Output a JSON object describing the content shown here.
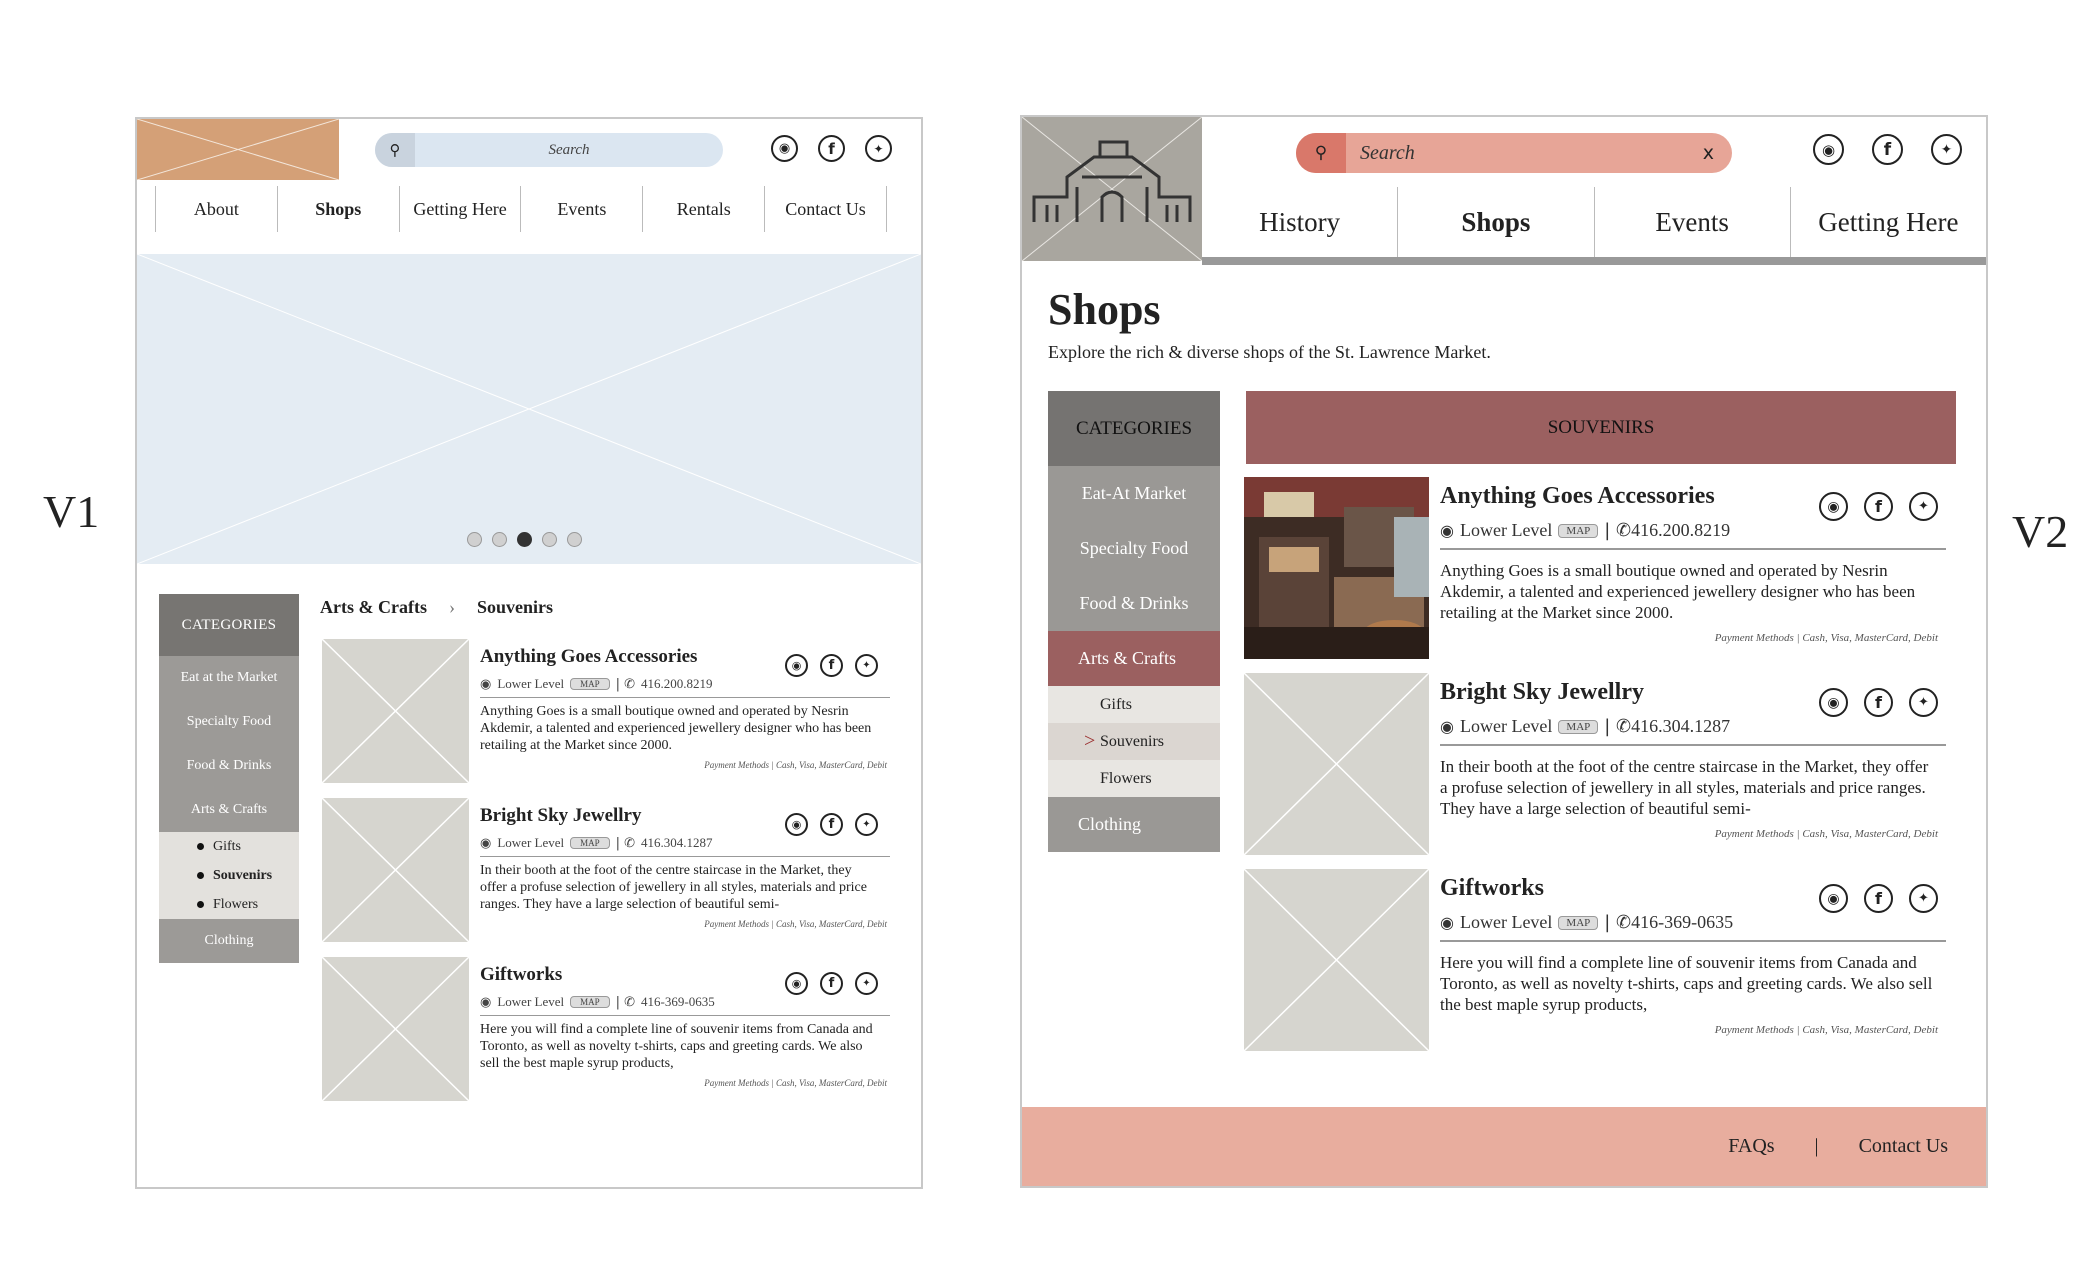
{
  "labels": {
    "v1": "V1",
    "v2": "V2"
  },
  "colors": {
    "v1_logo": "#d4a077",
    "v1_search_bg": "#dbe6f1",
    "v2_search_bg": "#e7a597",
    "v2_accent": "#9b6060",
    "v2_footer": "#e8ad9e",
    "placeholder": "#d6d5cf"
  },
  "v1": {
    "search_placeholder": "Search",
    "social_icons": [
      "instagram-icon",
      "facebook-icon",
      "twitter-icon"
    ],
    "nav": [
      "About",
      "Shops",
      "Getting Here",
      "Events",
      "Rentals",
      "Contact Us"
    ],
    "active_nav": "Shops",
    "carousel": {
      "count": 5,
      "active": 3
    },
    "categories": {
      "heading": "CATEGORIES",
      "items": [
        "Eat at the Market",
        "Specialty Food",
        "Food & Drinks",
        "Arts & Crafts"
      ],
      "sub_items": [
        "Gifts",
        "Souvenirs",
        "Flowers"
      ],
      "active_sub": "Souvenirs",
      "last_item": "Clothing"
    },
    "breadcrumb": {
      "parent": "Arts & Crafts",
      "separator": "›",
      "current": "Souvenirs"
    }
  },
  "v2": {
    "search_placeholder": "Search",
    "search_clear": "x",
    "nav": [
      "History",
      "Shops",
      "Events",
      "Getting Here"
    ],
    "active_nav": "Shops",
    "page_title": "Shops",
    "page_subtitle": "Explore the rich & diverse shops of the St. Lawrence Market.",
    "category_banner": "SOUVENIRS",
    "categories": {
      "heading": "CATEGORIES",
      "items": [
        "Eat-At Market",
        "Specialty Food",
        "Food & Drinks",
        "Arts & Crafts"
      ],
      "sub_items": [
        "Gifts",
        "Souvenirs",
        "Flowers"
      ],
      "active_sub": "Souvenirs",
      "active_marker": ">",
      "last_item": "Clothing"
    },
    "footer": {
      "faqs": "FAQs",
      "separator": "|",
      "contact": "Contact Us"
    }
  },
  "shops": [
    {
      "name": "Anything Goes Accessories",
      "location": "Lower Level",
      "map": "MAP",
      "phone": "416.200.8219",
      "desc": "Anything Goes is a small boutique owned and operated by Nesrin Akdemir, a talented and experienced jewellery designer who has been retailing at the Market since 2000.",
      "payment": "Payment Methods | Cash, Visa, MasterCard, Debit"
    },
    {
      "name": "Bright Sky Jewellry",
      "location": "Lower Level",
      "map": "MAP",
      "phone": "416.304.1287",
      "desc": "In their booth at the foot of the centre staircase in the Market, they offer a profuse selection of jewellery in all styles, materials and price ranges. They have a large selection of beautiful semi-",
      "payment": "Payment Methods | Cash, Visa, MasterCard, Debit"
    },
    {
      "name": "Giftworks",
      "location": "Lower Level",
      "map": "MAP",
      "phone": "416-369-0635",
      "desc": "Here you will find a complete line of souvenir items from Canada and Toronto, as well as novelty t-shirts, caps and greeting cards. We also sell the best maple syrup products,",
      "payment": "Payment Methods | Cash, Visa, MasterCard, Debit"
    }
  ]
}
